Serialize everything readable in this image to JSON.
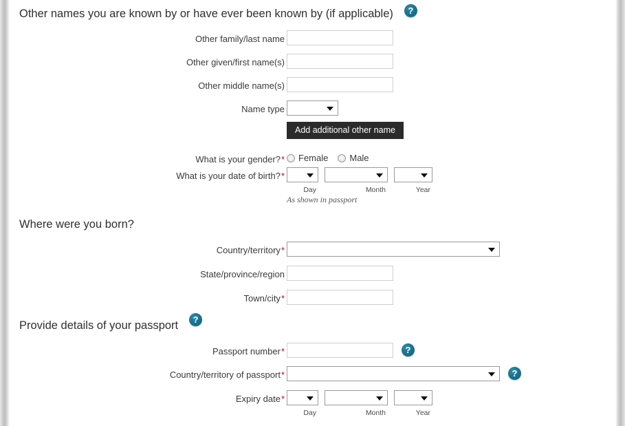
{
  "sections": {
    "other_names": {
      "heading": "Other names you are known by or have ever been known by (if applicable)",
      "help_icon": "help-icon",
      "help_glyph": "?",
      "fields": {
        "other_family_name": {
          "label": "Other family/last name",
          "value": "",
          "required": false
        },
        "other_given_names": {
          "label": "Other given/first name(s)",
          "value": "",
          "required": false
        },
        "other_middle_names": {
          "label": "Other middle name(s)",
          "value": "",
          "required": false
        },
        "name_type": {
          "label": "Name type",
          "value": "",
          "required": false
        }
      },
      "add_button": "Add additional other name"
    },
    "personal": {
      "gender": {
        "label": "What is your gender?",
        "required": true,
        "options": [
          "Female",
          "Male"
        ],
        "selected": ""
      },
      "date_of_birth": {
        "label": "What is your date of birth?",
        "required": true,
        "day": {
          "caption": "Day",
          "value": ""
        },
        "month": {
          "caption": "Month",
          "value": ""
        },
        "year": {
          "caption": "Year",
          "value": ""
        },
        "hint": "As shown in passport"
      }
    },
    "birthplace": {
      "heading": "Where were you born?",
      "fields": {
        "country": {
          "label": "Country/territory",
          "value": "",
          "required": true
        },
        "state": {
          "label": "State/province/region",
          "value": "",
          "required": false
        },
        "town": {
          "label": "Town/city",
          "value": "",
          "required": true
        }
      }
    },
    "passport": {
      "heading": "Provide details of your passport",
      "help_glyph": "?",
      "fields": {
        "passport_number": {
          "label": "Passport number",
          "value": "",
          "required": true
        },
        "passport_country": {
          "label": "Country/territory of passport",
          "value": "",
          "required": true
        },
        "expiry_date": {
          "label": "Expiry date",
          "required": true,
          "day": {
            "caption": "Day",
            "value": ""
          },
          "month": {
            "caption": "Month",
            "value": ""
          },
          "year": {
            "caption": "Year",
            "value": ""
          }
        }
      }
    }
  },
  "symbols": {
    "required_marker": "*",
    "dropdown_arrow": "dropdown-arrow-icon"
  },
  "colors": {
    "help_icon": "#15708c",
    "required": "#d0021b",
    "button": "#2b2b2b",
    "input_border": "#cfcfcf",
    "select_border": "#9a9a9a"
  }
}
